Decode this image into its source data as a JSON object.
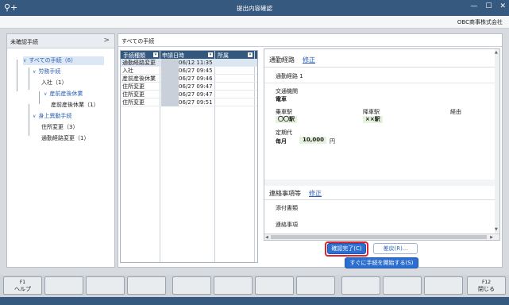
{
  "window": {
    "title": "提出内容確認",
    "app_icon": "user-plus-icon"
  },
  "company": "OBC商事株式会社",
  "left_pane": {
    "header": "未確認手続",
    "tree": [
      {
        "label": "すべての手続（6）"
      },
      {
        "label": "労務手続"
      },
      {
        "label": "入社（1）"
      },
      {
        "label": "産前産後休業"
      },
      {
        "label": "産前産後休業（1）"
      },
      {
        "label": "身上異動手続"
      },
      {
        "label": "住所変更（3）"
      },
      {
        "label": "通勤経路変更（1）"
      }
    ]
  },
  "main": {
    "header": "すべての手続",
    "grid": {
      "columns": [
        "手続種類",
        "申請日時",
        "所属"
      ],
      "rows": [
        {
          "type": "通勤経路変更",
          "date": "06/12 11:35"
        },
        {
          "type": "入社",
          "date": "06/27 09:45"
        },
        {
          "type": "産前産後休業",
          "date": "06/27 09:46"
        },
        {
          "type": "住所変更",
          "date": "06/27 09:47"
        },
        {
          "type": "住所変更",
          "date": "06/27 09:47"
        },
        {
          "type": "住所変更",
          "date": "06/27 09:51"
        }
      ]
    },
    "detail": {
      "commute": {
        "title": "通勤経路",
        "edit": "修正",
        "route_label": "通勤経路 1",
        "transport_label": "交通機関",
        "transport_value": "電車",
        "board_label": "乗車駅",
        "board_value": "〇〇駅",
        "alight_label": "降車駅",
        "alight_value": "××駅",
        "via_label": "経由",
        "pass_label": "定期代",
        "period": "毎月",
        "amount": "10,000",
        "unit": "円"
      },
      "contact": {
        "title": "連絡事項等",
        "edit": "修正",
        "attach_label": "添付書類",
        "notes_label": "連絡事項"
      }
    },
    "buttons": {
      "confirm": "確認完了(C)",
      "return": "差戻(R)...",
      "start": "すぐに手続を開始する(S)"
    }
  },
  "function_keys": [
    {
      "key": "F1",
      "label": "ヘルプ"
    },
    {
      "key": "",
      "label": ""
    },
    {
      "key": "",
      "label": ""
    },
    {
      "key": "",
      "label": ""
    },
    {
      "key": "",
      "label": ""
    },
    {
      "key": "",
      "label": ""
    },
    {
      "key": "",
      "label": ""
    },
    {
      "key": "",
      "label": ""
    },
    {
      "key": "",
      "label": ""
    },
    {
      "key": "",
      "label": ""
    },
    {
      "key": "",
      "label": ""
    },
    {
      "key": "F12",
      "label": "閉じる"
    }
  ]
}
